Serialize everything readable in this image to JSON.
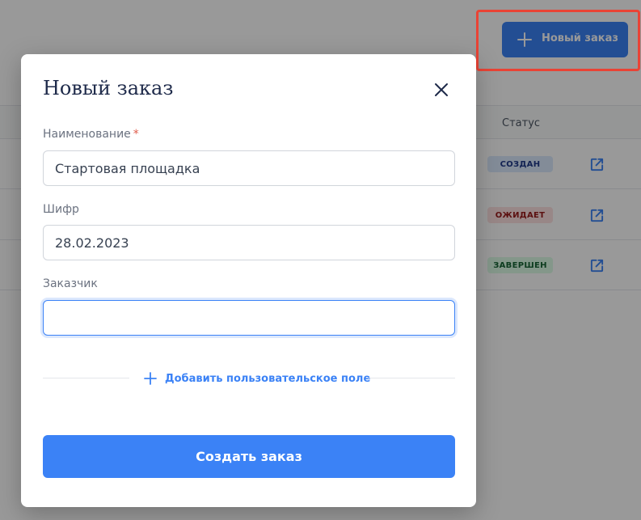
{
  "header": {
    "new_order_button": "Новый заказ"
  },
  "table": {
    "status_header": "Статус",
    "rows": [
      {
        "status": "СОЗДАН",
        "status_bg": "#dbeafe",
        "status_color": "#1e3a8a"
      },
      {
        "status": "ОЖИДАЕТ",
        "status_bg": "#fee2e2",
        "status_color": "#991b1b"
      },
      {
        "status": "ЗАВЕРШЕН",
        "status_bg": "#dcfce7",
        "status_color": "#166534"
      }
    ]
  },
  "modal": {
    "title": "Новый заказ",
    "fields": {
      "name": {
        "label": "Наименование",
        "required_mark": "*",
        "value": "Стартовая площадка"
      },
      "cipher": {
        "label": "Шифр",
        "value": "28.02.2023"
      },
      "customer": {
        "label": "Заказчик",
        "value": ""
      }
    },
    "add_field_label": "Добавить пользовательское поле",
    "submit_label": "Создать заказ"
  },
  "colors": {
    "accent": "#3b82f6",
    "highlight": "#ea4335",
    "required": "#e05d4b"
  },
  "icons": {
    "plus": "plus-icon",
    "close": "close-icon",
    "open": "external-link-icon"
  }
}
